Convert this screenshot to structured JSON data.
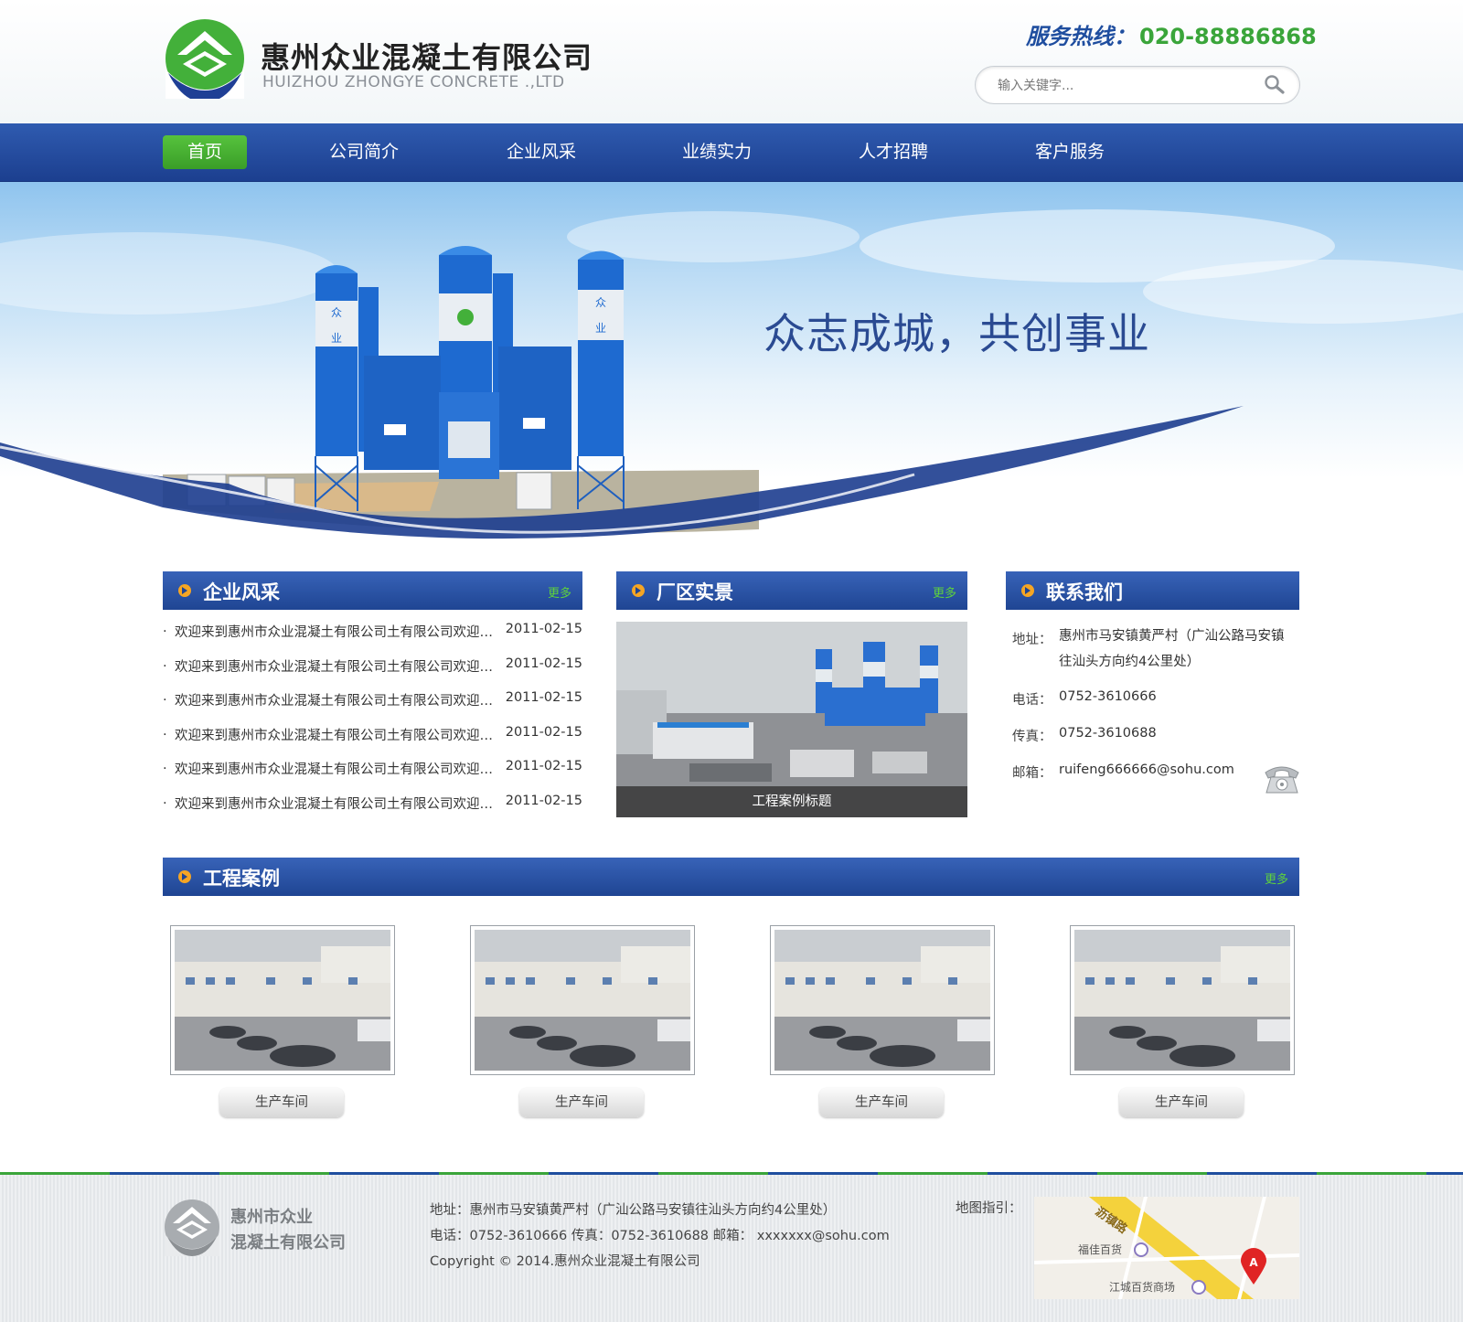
{
  "header": {
    "company_cn": "惠州众业混凝土有限公司",
    "company_en": "HUIZHOU ZHONGYE CONCRETE .,LTD",
    "hotline_label": "服务热线：",
    "hotline_number": "020-88886868",
    "search_placeholder": "输入关键字..."
  },
  "nav": {
    "items": [
      {
        "label": "首页",
        "active": true
      },
      {
        "label": "公司简介"
      },
      {
        "label": "企业风采"
      },
      {
        "label": "业绩实力"
      },
      {
        "label": "人才招聘"
      },
      {
        "label": "客户服务"
      }
    ]
  },
  "banner": {
    "slogan": "众志成城，共创事业",
    "silo_labels": [
      "众",
      "业",
      "众",
      "业"
    ]
  },
  "news": {
    "title": "企业风采",
    "more": "更多",
    "items": [
      {
        "text": "欢迎来到惠州市众业混凝土有限公司土有限公司欢迎来到惠州市众业混凝土有限公司",
        "date": "2011-02-15"
      },
      {
        "text": "欢迎来到惠州市众业混凝土有限公司土有限公司欢迎来到惠州市众业混凝土有限公司",
        "date": "2011-02-15"
      },
      {
        "text": "欢迎来到惠州市众业混凝土有限公司土有限公司欢迎来到惠州市众业混凝土有限公司",
        "date": "2011-02-15"
      },
      {
        "text": "欢迎来到惠州市众业混凝土有限公司土有限公司欢迎来到惠州市众业混凝土有限公司",
        "date": "2011-02-15"
      },
      {
        "text": "欢迎来到惠州市众业混凝土有限公司土有限公司欢迎来到惠州市众业混凝土有限公司",
        "date": "2011-02-15"
      },
      {
        "text": "欢迎来到惠州市众业混凝土有限公司土有限公司欢迎来到惠州市众业混凝土有限公司",
        "date": "2011-02-15"
      }
    ]
  },
  "factory": {
    "title": "厂区实景",
    "more": "更多",
    "caption": "工程案例标题"
  },
  "contact": {
    "title": "联系我们",
    "address_label": "地址：",
    "address": "惠州市马安镇黄严村（广汕公路马安镇往汕头方向约4公里处）",
    "tel_label": "电话：",
    "tel": "0752-3610666",
    "fax_label": "传真：",
    "fax": "0752-3610688",
    "email_label": "邮箱：",
    "email": "ruifeng666666@sohu.com"
  },
  "cases": {
    "title": "工程案例",
    "more": "更多",
    "items": [
      {
        "label": "生产车间"
      },
      {
        "label": "生产车间"
      },
      {
        "label": "生产车间"
      },
      {
        "label": "生产车间"
      }
    ]
  },
  "footer": {
    "name_line1": "惠州市众业",
    "name_line2": "混凝土有限公司",
    "address_line": "地址：惠州市马安镇黄严村（广汕公路马安镇往汕头方向约4公里处）",
    "contact_line": "电话：0752-3610666 传真：0752-3610688 邮箱： xxxxxxx@sohu.com",
    "copyright": "Copyright © 2014.惠州众业混凝土有限公司",
    "map_label": "地图指引：",
    "map_road": "沥镇路",
    "map_place1": "福佳百货",
    "map_place2": "江城百货商场",
    "map_marker": "A"
  },
  "colors": {
    "brand_blue": "#1f4e9f",
    "brand_green": "#3aa53a",
    "accent_orange": "#f5a524"
  }
}
